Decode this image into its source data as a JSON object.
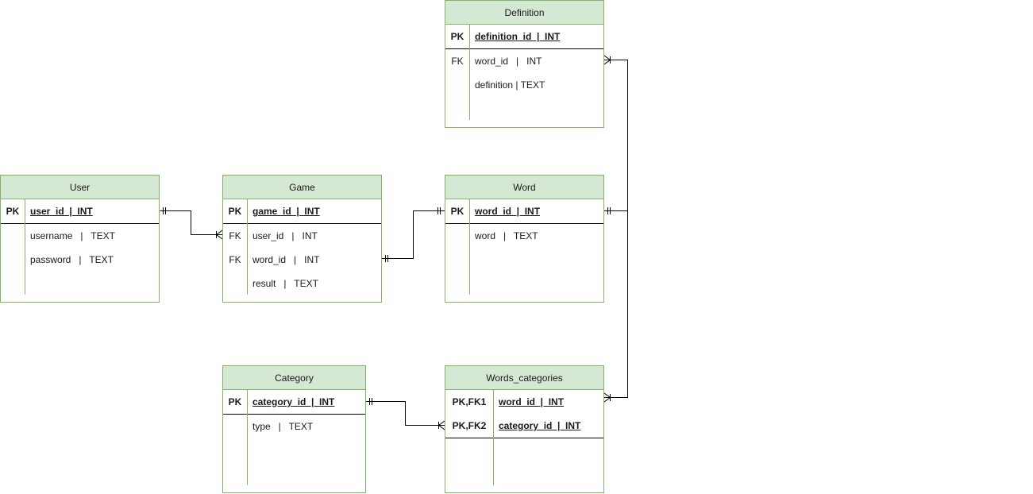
{
  "diagram": {
    "type": "er-diagram",
    "entities": {
      "definition": {
        "title": "Definition",
        "rows": [
          {
            "key": "PK",
            "field": "definition_id  |  INT",
            "primary": true
          },
          {
            "key": "FK",
            "field": "word_id   |   INT"
          },
          {
            "key": "",
            "field": "definition | TEXT"
          }
        ]
      },
      "user": {
        "title": "User",
        "rows": [
          {
            "key": "PK",
            "field": "user_id  |  INT",
            "primary": true
          },
          {
            "key": "",
            "field": "username   |   TEXT"
          },
          {
            "key": "",
            "field": "password   |   TEXT"
          }
        ]
      },
      "game": {
        "title": "Game",
        "rows": [
          {
            "key": "PK",
            "field": "game_id  |  INT",
            "primary": true
          },
          {
            "key": "FK",
            "field": "user_id   |   INT"
          },
          {
            "key": "FK",
            "field": "word_id   |   INT"
          },
          {
            "key": "",
            "field": "result   |   TEXT"
          }
        ]
      },
      "word": {
        "title": "Word",
        "rows": [
          {
            "key": "PK",
            "field": "word_id  |  INT",
            "primary": true
          },
          {
            "key": "",
            "field": "word   |   TEXT"
          }
        ]
      },
      "category": {
        "title": "Category",
        "rows": [
          {
            "key": "PK",
            "field": "category_id  |  INT",
            "primary": true
          },
          {
            "key": "",
            "field": "type   |   TEXT"
          }
        ]
      },
      "words_categories": {
        "title": "Words_categories",
        "rows": [
          {
            "key": "PK,FK1",
            "field": "word_id  |  INT",
            "primary": true
          },
          {
            "key": "PK,FK2",
            "field": "category_id  |  INT",
            "primary": true
          }
        ]
      }
    },
    "relationships": [
      {
        "from": "User.user_id",
        "to": "Game.user_id",
        "from_card": "one-and-only-one",
        "to_card": "one-or-many"
      },
      {
        "from": "Word.word_id",
        "to": "Game.word_id",
        "from_card": "one-and-only-one",
        "to_card": "one-and-only-one"
      },
      {
        "from": "Word.word_id",
        "to": "Definition.word_id",
        "from_card": "one-and-only-one",
        "to_card": "one-or-many"
      },
      {
        "from": "Word.word_id",
        "to": "Words_categories.word_id",
        "from_card": "one-and-only-one",
        "to_card": "one-or-many"
      },
      {
        "from": "Category.category_id",
        "to": "Words_categories.category_id",
        "from_card": "one-and-only-one",
        "to_card": "one-or-many"
      }
    ],
    "colors": {
      "header_fill": "#d5e8d4",
      "border": "#82b366",
      "line": "#000000"
    }
  }
}
